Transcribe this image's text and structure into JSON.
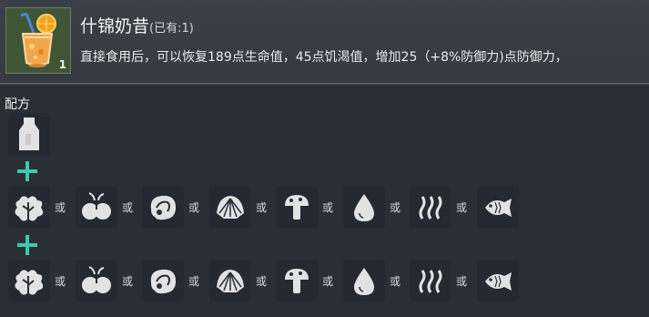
{
  "item": {
    "name": "什锦奶昔",
    "owned": "(已有:1)",
    "quantity": "1",
    "description": "直接食用后，可以恢复189点生命值，45点饥渴值，增加25（+8%防御力)点防御力，",
    "icon": "smoothie-glass-icon"
  },
  "recipe": {
    "label": "配方",
    "base_icon": "milk-bottle-icon",
    "or_text": "或",
    "options": [
      {
        "icon": "leafy-vegetable-icon"
      },
      {
        "icon": "berries-icon"
      },
      {
        "icon": "raw-meat-icon"
      },
      {
        "icon": "shell-icon"
      },
      {
        "icon": "mushroom-icon"
      },
      {
        "icon": "water-drop-icon"
      },
      {
        "icon": "steam-icon"
      },
      {
        "icon": "fish-icon"
      }
    ]
  },
  "colors": {
    "background": "#2a2e36",
    "header": "#383d46",
    "slot": "#252931",
    "plus": "#3dc9b0",
    "icon": "#e2e2e2"
  }
}
